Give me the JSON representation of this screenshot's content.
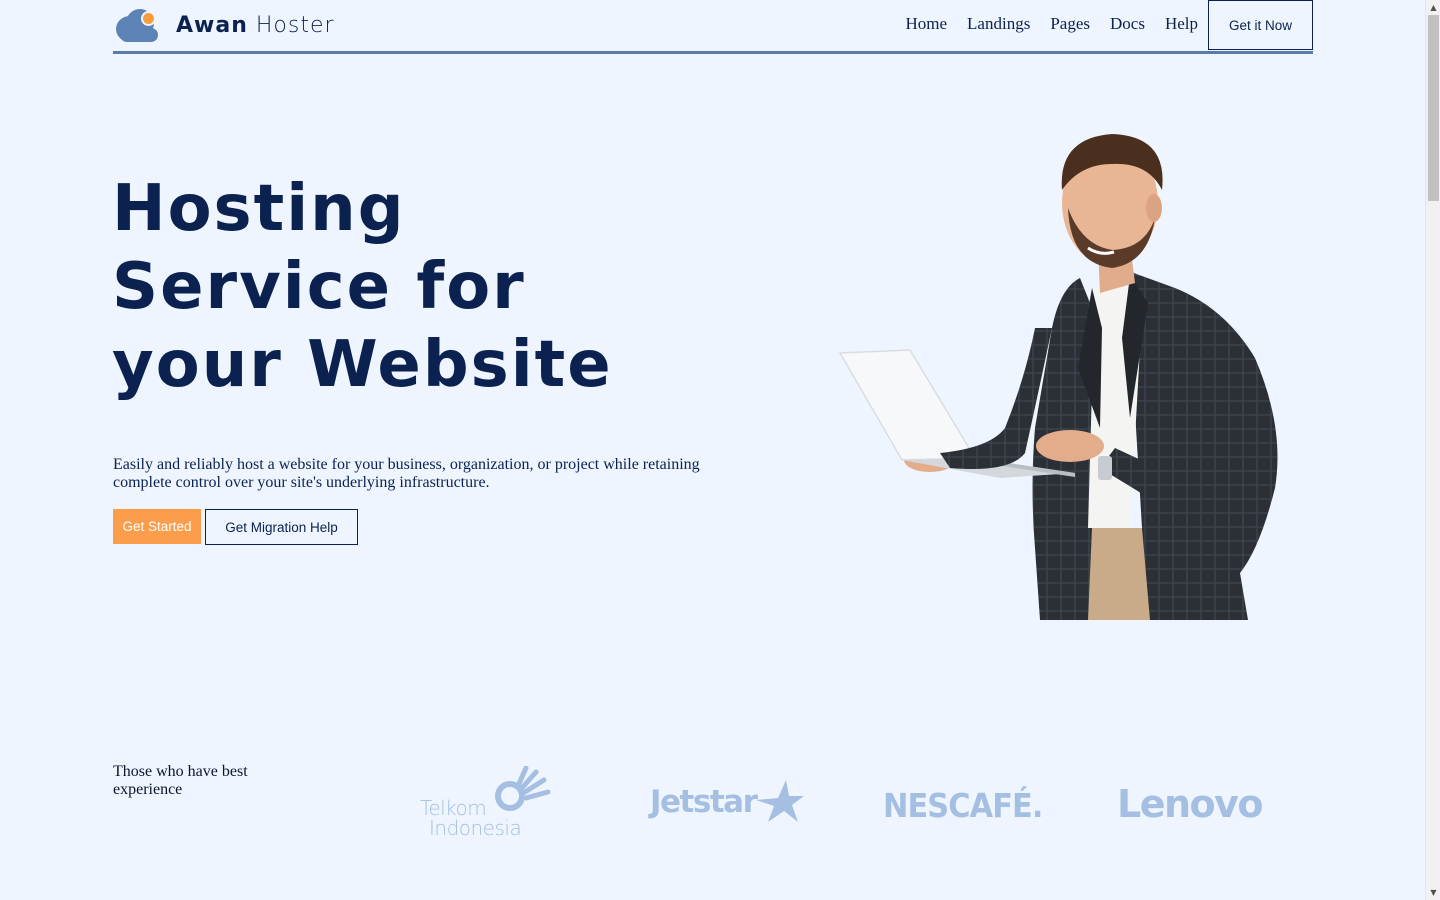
{
  "brand": {
    "name_bold": "Awan",
    "name_light": "Hoster"
  },
  "nav": {
    "links": [
      "Home",
      "Landings",
      "Pages",
      "Docs",
      "Help"
    ],
    "cta": "Get it Now"
  },
  "hero": {
    "title_lines": [
      "Hosting",
      "Service for",
      "your Website"
    ],
    "description": "Easily and reliably host a website for your business, organization, or project while retaining complete control over your site's underlying infrastructure.",
    "primary_button": "Get Started",
    "secondary_button": "Get Migration Help"
  },
  "clients": {
    "heading": "Those who have best experience",
    "logos": {
      "telkom_line1": "Telkom",
      "telkom_line2": "Indonesia",
      "jetstar": "Jetstar",
      "nescafe": "NESCAFÉ.",
      "lenovo": "Lenovo"
    }
  },
  "colors": {
    "background": "#eef5fe",
    "primary_text": "#0b2150",
    "accent_orange": "#fb9d4a",
    "nav_underline": "#5a7ba6",
    "logo_blue": "#a5bfe2"
  }
}
